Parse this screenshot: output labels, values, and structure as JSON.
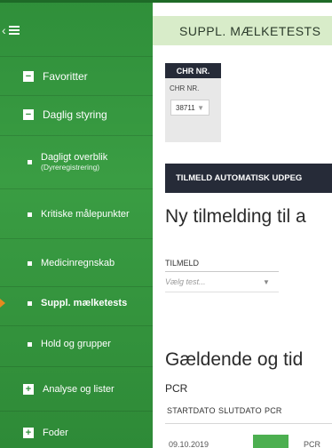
{
  "sidebar": {
    "items": [
      {
        "label": "Favoritter",
        "kind": "collapse",
        "glyph": "−"
      },
      {
        "label": "Daglig styring",
        "kind": "collapse",
        "glyph": "−"
      },
      {
        "label": "Dagligt overblik",
        "sublabel": "(Dyreregistrering)",
        "kind": "sub"
      },
      {
        "label": "Kritiske målepunkter",
        "kind": "sub"
      },
      {
        "label": "Medicinregnskab",
        "kind": "sub"
      },
      {
        "label": "Suppl. mælketests",
        "kind": "sub",
        "active": true
      },
      {
        "label": "Hold og grupper",
        "kind": "sub"
      },
      {
        "label": "Analyse og lister",
        "kind": "expand",
        "glyph": "+"
      },
      {
        "label": "Foder",
        "kind": "expand",
        "glyph": "+"
      }
    ]
  },
  "main": {
    "tab_title": "SUPPL. MÆLKETESTS",
    "chr": {
      "header": "CHR NR.",
      "sublabel": "CHR NR.",
      "value": "38711",
      "caret": "▼"
    },
    "auto_button_label": "TILMELD AUTOMATISK UDPEG",
    "heading": "Ny tilmelding til a",
    "tilmeld_label": "TILMELD",
    "test_placeholder": "Vælg test...",
    "caret": "▼",
    "heading2": "Gældende og tid",
    "pcr_label": "PCR",
    "columns": [
      "STARTDATO",
      "SLUTDATO",
      "PCR"
    ],
    "row": {
      "date": "09.10.2019",
      "pcr": "PCR"
    }
  },
  "colors": {
    "sidebar_green": "#3a9d43",
    "tab_bar": "#d8ecc9",
    "dark_button": "#262b38",
    "active_marker": "#e58a1f"
  }
}
